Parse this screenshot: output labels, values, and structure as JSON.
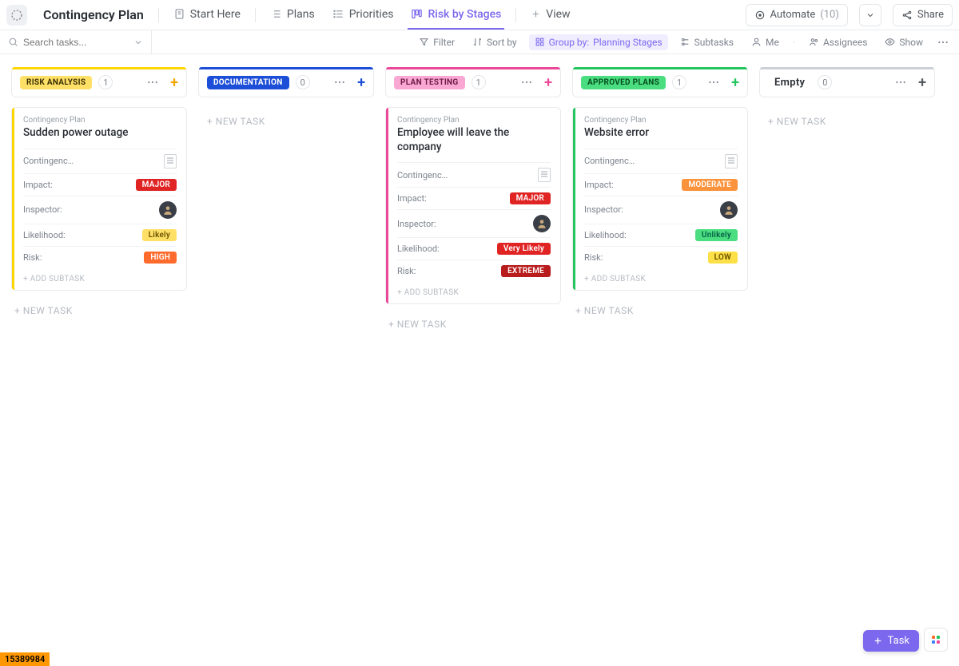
{
  "header": {
    "space_title": "Contingency Plan",
    "tabs": [
      {
        "label": "Start Here",
        "icon": "doc-star"
      },
      {
        "label": "Plans",
        "icon": "list-numbered"
      },
      {
        "label": "Priorities",
        "icon": "list-bullets"
      },
      {
        "label": "Risk by Stages",
        "icon": "board",
        "active": true
      },
      {
        "label": "View",
        "icon": "plus"
      }
    ],
    "automate_label": "Automate",
    "automate_count": "(10)",
    "share_label": "Share"
  },
  "toolbar": {
    "search_placeholder": "Search tasks...",
    "filter": "Filter",
    "sort": "Sort by",
    "group_prefix": "Group by:",
    "group_value": "Planning Stages",
    "subtasks": "Subtasks",
    "me": "Me",
    "assignees": "Assignees",
    "show": "Show"
  },
  "labels": {
    "new_task": "+ NEW TASK",
    "add_subtask": "+ ADD SUBTASK"
  },
  "columns": [
    {
      "name": "RISK ANALYSIS",
      "count": "1",
      "bar": "#ffd600",
      "pill_bg": "#ffe066",
      "pill_fg": "#3a3005",
      "plus_color": "#f2a600",
      "cards": [
        {
          "list": "Contingency Plan",
          "title": "Sudden power outage",
          "fields": [
            {
              "label": "Contingenc…",
              "type": "doc"
            },
            {
              "label": "Impact:",
              "type": "badge",
              "value": "MAJOR",
              "bg": "#e02424",
              "fg": "#fff"
            },
            {
              "label": "Inspector:",
              "type": "avatar"
            },
            {
              "label": "Likelihood:",
              "type": "badge",
              "value": "Likely",
              "bg": "#ffe066",
              "fg": "#6a5300"
            },
            {
              "label": "Risk:",
              "type": "badge",
              "value": "HIGH",
              "bg": "#ff6b2c",
              "fg": "#fff"
            }
          ]
        }
      ]
    },
    {
      "name": "DOCUMENTATION",
      "count": "0",
      "bar": "#1d4ed8",
      "pill_bg": "#1d4ed8",
      "pill_fg": "#fff",
      "plus_color": "#1d4ed8",
      "cards": []
    },
    {
      "name": "PLAN TESTING",
      "count": "1",
      "bar": "#ec4899",
      "pill_bg": "#f9a8d4",
      "pill_fg": "#701a47",
      "plus_color": "#ec4899",
      "cards": [
        {
          "list": "Contingency Plan",
          "title": "Employee will leave the company",
          "fields": [
            {
              "label": "Contingenc…",
              "type": "doc"
            },
            {
              "label": "Impact:",
              "type": "badge",
              "value": "MAJOR",
              "bg": "#e02424",
              "fg": "#fff"
            },
            {
              "label": "Inspector:",
              "type": "avatar"
            },
            {
              "label": "Likelihood:",
              "type": "badge",
              "value": "Very Likely",
              "bg": "#e02424",
              "fg": "#fff"
            },
            {
              "label": "Risk:",
              "type": "badge",
              "value": "EXTREME",
              "bg": "#b91c1c",
              "fg": "#fff"
            }
          ]
        }
      ]
    },
    {
      "name": "APPROVED PLANS",
      "count": "1",
      "bar": "#22c55e",
      "pill_bg": "#4ade80",
      "pill_fg": "#064e1f",
      "plus_color": "#22c55e",
      "cards": [
        {
          "list": "Contingency Plan",
          "title": "Website error",
          "fields": [
            {
              "label": "Contingenc…",
              "type": "doc"
            },
            {
              "label": "Impact:",
              "type": "badge",
              "value": "MODERATE",
              "bg": "#fb923c",
              "fg": "#fff"
            },
            {
              "label": "Inspector:",
              "type": "avatar"
            },
            {
              "label": "Likelihood:",
              "type": "badge",
              "value": "Unlikely",
              "bg": "#4ade80",
              "fg": "#065f46"
            },
            {
              "label": "Risk:",
              "type": "badge",
              "value": "LOW",
              "bg": "#fde047",
              "fg": "#6a5300"
            }
          ]
        }
      ]
    },
    {
      "name": "Empty",
      "count": "0",
      "bar": "#cbd0d6",
      "pill_bg": "transparent",
      "pill_fg": "#54595f",
      "plus_color": "#54595f",
      "plain": true,
      "cards": []
    }
  ],
  "footer": {
    "id_chip": "15389984",
    "task_button": "Task"
  }
}
